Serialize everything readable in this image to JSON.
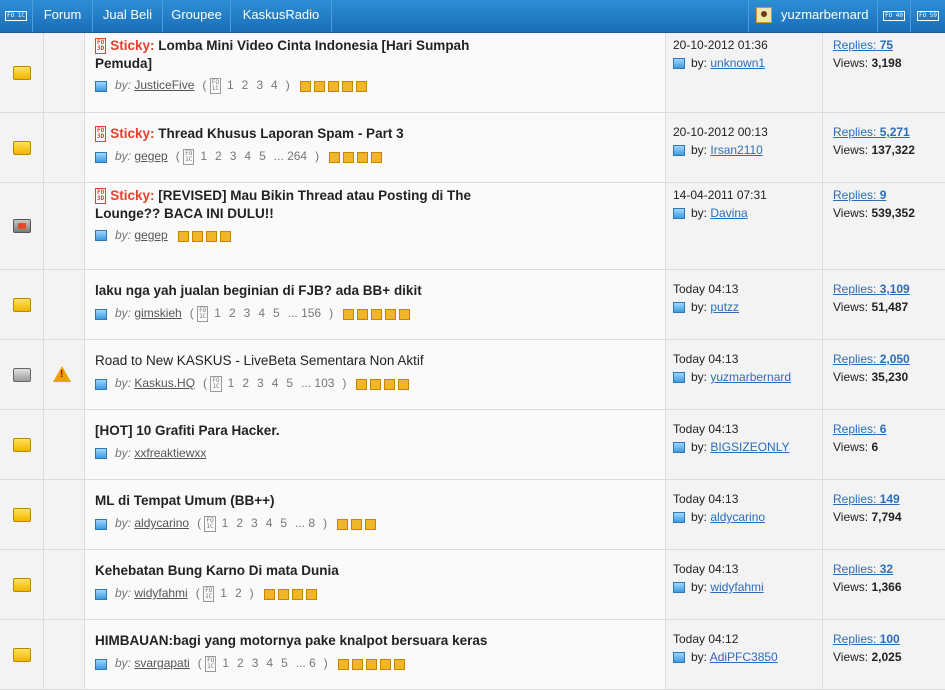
{
  "nav": {
    "items": [
      "Forum",
      "Jual Beli",
      "Groupee",
      "KaskusRadio"
    ],
    "icon_left": "FO 1C",
    "icon_right_1": "FO 40",
    "icon_right_2": "FO 59",
    "username": "yuzmarbernard"
  },
  "sticky_label": "Sticky:",
  "by_label": "by:",
  "replies_label": "Replies:",
  "views_label": "Views:",
  "threads": [
    {
      "sticky": true,
      "status": "normal",
      "title_1": "Lomba Mini Video Cinta Indonesia [Hari Sumpah",
      "title_2": "Pemuda]",
      "author": "JusticeFive",
      "pages": [
        "1",
        "2",
        "3",
        "4"
      ],
      "pages_end": "",
      "stars": 5,
      "last_date": "20-10-2012 01:36",
      "last_by": "unknown1",
      "replies": "75",
      "views": "3,198"
    },
    {
      "sticky": true,
      "status": "normal",
      "title_1": "Thread Khusus Laporan Spam - Part 3",
      "title_2": "",
      "author": "gegep",
      "pages": [
        "1",
        "2",
        "3",
        "4",
        "5"
      ],
      "pages_end": "... 264",
      "stars": 4,
      "last_date": "20-10-2012 00:13",
      "last_by": "Irsan2110",
      "replies": "5,271",
      "views": "137,322"
    },
    {
      "sticky": true,
      "status": "locked",
      "title_1": "[REVISED] Mau Bikin Thread atau Posting di The",
      "title_2": "Lounge?? BACA INI DULU!!",
      "author": "gegep",
      "pages": [],
      "pages_end": "",
      "stars": 4,
      "last_date": "14-04-2011 07:31",
      "last_by": "Davina",
      "replies": "9",
      "views": "539,352"
    },
    {
      "sticky": false,
      "status": "normal",
      "title_1": "laku nga yah jualan beginian di FJB? ada BB+ dikit",
      "title_2": "",
      "author": "gimskieh",
      "pages": [
        "1",
        "2",
        "3",
        "4",
        "5"
      ],
      "pages_end": "... 156",
      "stars": 5,
      "last_date": "Today 04:13",
      "last_by": "putzz",
      "replies": "3,109",
      "views": "51,487"
    },
    {
      "sticky": false,
      "status": "gray",
      "warning": true,
      "normal_weight": true,
      "title_1": "Road to New KASKUS - LiveBeta Sementara Non Aktif",
      "title_2": "",
      "author": "Kaskus.HQ",
      "pages": [
        "1",
        "2",
        "3",
        "4",
        "5"
      ],
      "pages_end": "... 103",
      "stars": 4,
      "last_date": "Today 04:13",
      "last_by": "yuzmarbernard",
      "replies": "2,050",
      "views": "35,230"
    },
    {
      "sticky": false,
      "status": "normal",
      "title_1": "[HOT] 10 Grafiti Para Hacker.",
      "title_2": "",
      "author": "xxfreaktiewxx",
      "pages": [],
      "pages_end": "",
      "stars": 0,
      "last_date": "Today 04:13",
      "last_by": "BIGSIZEONLY",
      "replies": "6",
      "views": "6"
    },
    {
      "sticky": false,
      "status": "normal",
      "title_1": "ML di Tempat Umum (BB++)",
      "title_2": "",
      "author": "aldycarino",
      "pages": [
        "1",
        "2",
        "3",
        "4",
        "5"
      ],
      "pages_end": "... 8",
      "stars": 3,
      "last_date": "Today 04:13",
      "last_by": "aldycarino",
      "replies": "149",
      "views": "7,794"
    },
    {
      "sticky": false,
      "status": "normal",
      "title_1": "Kehebatan Bung Karno Di mata Dunia",
      "title_2": "",
      "author": "widyfahmi",
      "pages": [
        "1",
        "2"
      ],
      "pages_end": "",
      "stars": 4,
      "last_date": "Today 04:13",
      "last_by": "widyfahmi",
      "replies": "32",
      "views": "1,366"
    },
    {
      "sticky": false,
      "status": "normal",
      "title_1": "HIMBAUAN:bagi yang motornya pake knalpot bersuara keras",
      "title_2": "",
      "author": "svargapati",
      "pages": [
        "1",
        "2",
        "3",
        "4",
        "5"
      ],
      "pages_end": "... 6",
      "stars": 5,
      "last_date": "Today 04:12",
      "last_by": "AdiPFC3850",
      "replies": "100",
      "views": "2,025"
    }
  ]
}
